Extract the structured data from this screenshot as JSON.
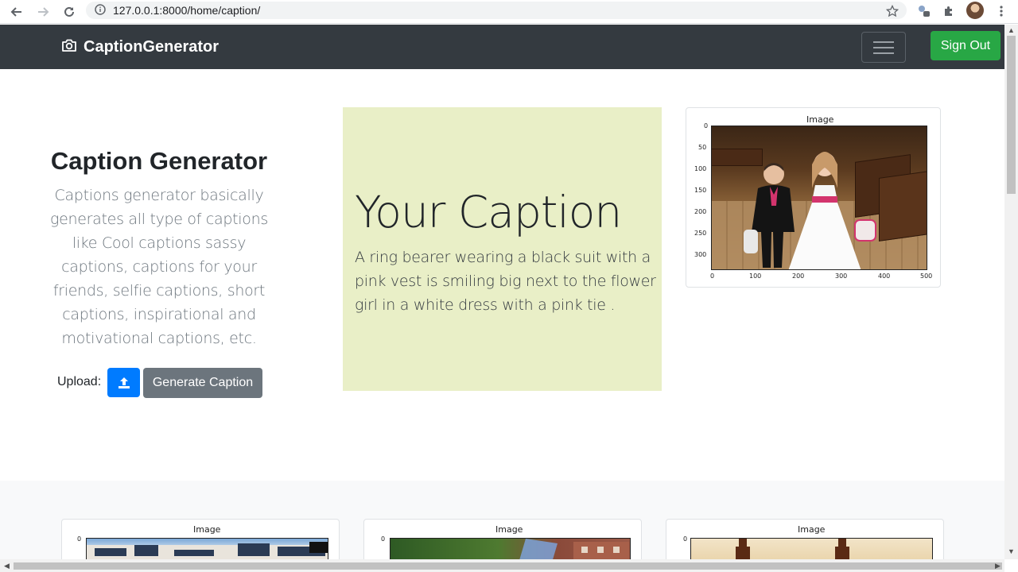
{
  "browser": {
    "url": "127.0.0.1:8000/home/caption/"
  },
  "navbar": {
    "brand": "CaptionGenerator",
    "signout_label": "Sign Out"
  },
  "hero": {
    "title": "Caption Generator",
    "description": "Captions generator basically generates all type of captions like Cool captions sassy captions, captions for your friends, selfie captions, short captions, inspirational and motivational captions, etc.",
    "upload_label": "Upload:",
    "generate_label": "Generate Caption"
  },
  "caption": {
    "heading": "Your Caption",
    "text": "A ring bearer wearing a black suit with a pink vest is smiling big next to the flower girl in a white dress with a pink tie ."
  },
  "main_plot": {
    "title": "Image",
    "y_ticks": [
      "0",
      "50",
      "100",
      "150",
      "200",
      "250",
      "300"
    ],
    "x_ticks": [
      "0",
      "100",
      "200",
      "300",
      "400",
      "500"
    ]
  },
  "gallery": [
    {
      "title": "Image",
      "y_tick": "0"
    },
    {
      "title": "Image",
      "y_tick": "0"
    },
    {
      "title": "Image",
      "y_tick": "0"
    }
  ],
  "colors": {
    "navbar": "#343a40",
    "signout": "#28a745",
    "upload": "#007bff",
    "generate": "#6c757d",
    "caption_bg": "#e9efc7"
  }
}
